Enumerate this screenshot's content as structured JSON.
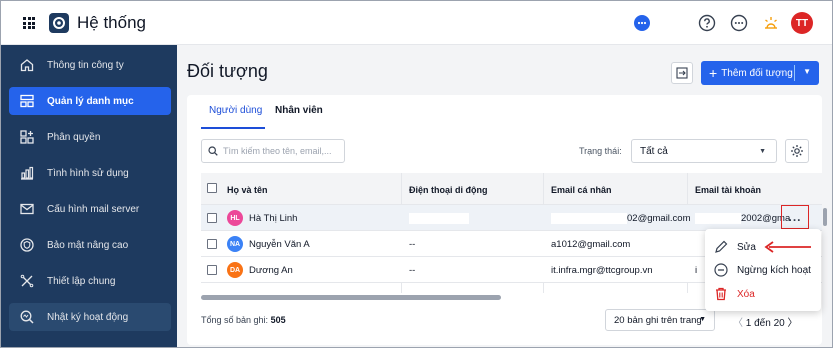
{
  "app": {
    "title": "Hệ thống",
    "user_initials": "TT"
  },
  "colors": {
    "sidebar": "#1e3a5f",
    "accent": "#2563eb",
    "danger": "#dc2626"
  },
  "sidebar": {
    "items": [
      {
        "label": "Thông tin công ty",
        "icon": "home-icon"
      },
      {
        "label": "Quản lý danh mục",
        "icon": "catalog-icon",
        "active": true
      },
      {
        "label": "Phân quyền",
        "icon": "permission-icon"
      },
      {
        "label": "Tình hình sử dụng",
        "icon": "chart-icon"
      },
      {
        "label": "Cấu hình mail server",
        "icon": "mail-config-icon"
      },
      {
        "label": "Bảo mật nâng cao",
        "icon": "shield-icon"
      },
      {
        "label": "Thiết lập chung",
        "icon": "tools-icon"
      },
      {
        "label": "Nhật ký hoạt động",
        "icon": "activity-log-icon"
      }
    ]
  },
  "main": {
    "title": "Đối tượng",
    "add_button_label": "Thêm đối tượng",
    "tabs": [
      {
        "label": "Người dùng"
      },
      {
        "label": "Nhân viên"
      }
    ],
    "search_placeholder": "Tìm kiếm theo tên, email,...",
    "status_label": "Trạng thái:",
    "status_value": "Tất cả"
  },
  "table": {
    "columns": [
      "Họ và tên",
      "Điện thoại di động",
      "Email cá nhân",
      "Email tài khoản"
    ],
    "rows": [
      {
        "initials": "HL",
        "name": "Hà Thị Linh",
        "phone": "",
        "email": "02@gmail.com",
        "account": "2002@gma",
        "avatar_color": "#ec4899"
      },
      {
        "initials": "NA",
        "name": "Nguyễn Văn A",
        "phone": "--",
        "email": "a1012@gmail.com",
        "account": "",
        "avatar_color": "#3b82f6"
      },
      {
        "initials": "DA",
        "name": "Dương An",
        "phone": "--",
        "email": "it.infra.mgr@ttcgroup.vn",
        "account": "i",
        "avatar_color": "#f97316"
      }
    ],
    "row_action_label": "..."
  },
  "footer": {
    "total_label": "Tổng số bản ghi:",
    "total_value": "505",
    "per_page": "20 bản ghi trên trang",
    "pager_text": "1  đến  20"
  },
  "context_menu": {
    "items": [
      {
        "label": "Sửa",
        "icon": "edit-pencil-icon"
      },
      {
        "label": "Ngừng kích hoạt",
        "icon": "deactivate-icon"
      },
      {
        "label": "Xóa",
        "icon": "trash-icon"
      }
    ]
  }
}
